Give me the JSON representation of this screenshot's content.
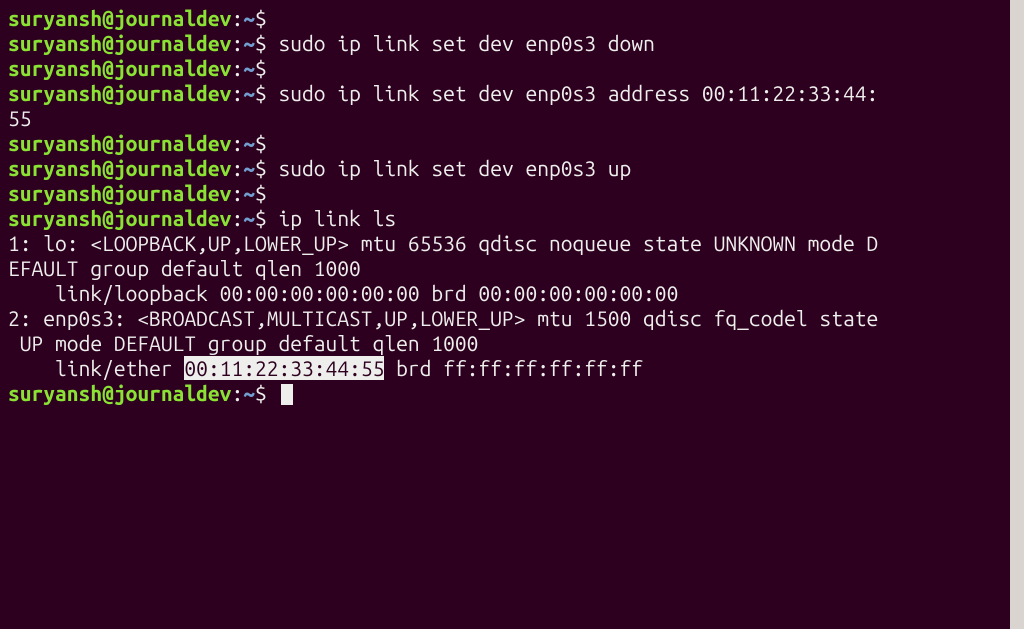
{
  "prompt": {
    "user_host": "suryansh@journaldev",
    "path": "~",
    "sep": ":",
    "end": "$"
  },
  "lines": {
    "cmd1": "sudo ip link set dev enp0s3 down",
    "cmd2a": "sudo ip link set dev enp0s3 address 00:11:22:33:44:",
    "cmd2b": "55",
    "cmd3": "sudo ip link set dev enp0s3 up",
    "cmd4": "ip link ls"
  },
  "output": {
    "o1": "1: lo: <LOOPBACK,UP,LOWER_UP> mtu 65536 qdisc noqueue state UNKNOWN mode D",
    "o2": "EFAULT group default qlen 1000",
    "o3": "    link/loopback 00:00:00:00:00:00 brd 00:00:00:00:00:00",
    "o4": "2: enp0s3: <BROADCAST,MULTICAST,UP,LOWER_UP> mtu 1500 qdisc fq_codel state",
    "o5": " UP mode DEFAULT group default qlen 1000",
    "o6a": "    link/ether ",
    "o6_hl": "00:11:22:33:44:55",
    "o6b": " brd ff:ff:ff:ff:ff:ff"
  }
}
